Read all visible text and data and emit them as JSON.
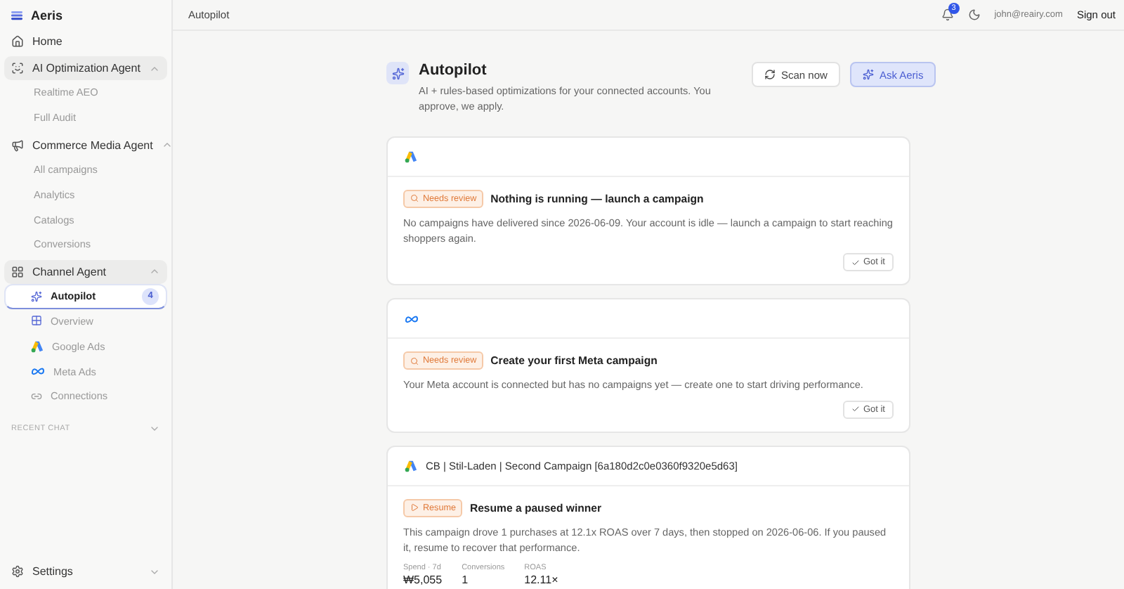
{
  "sidebar": {
    "brand": "Aeris",
    "items": [
      {
        "kind": "link",
        "label": "Home",
        "active": false
      },
      {
        "kind": "group",
        "label": "AI Optimization Agent",
        "active": true,
        "expanded": true,
        "children": [
          {
            "label": "Realtime AEO",
            "selected": false
          },
          {
            "label": "Full Audit",
            "selected": false
          }
        ]
      },
      {
        "kind": "group",
        "label": "Commerce Media Agent",
        "active": false,
        "expanded": true,
        "children": [
          {
            "label": "All campaigns",
            "selected": false
          },
          {
            "label": "Analytics",
            "selected": false
          },
          {
            "label": "Catalogs",
            "selected": false
          },
          {
            "label": "Conversions",
            "selected": false
          }
        ]
      },
      {
        "kind": "group",
        "label": "Channel Agent",
        "active": true,
        "expanded": true,
        "children": [
          {
            "label": "Autopilot",
            "selected": true,
            "badge": "4"
          },
          {
            "label": "Overview",
            "selected": false
          },
          {
            "label": "Google Ads",
            "selected": false
          },
          {
            "label": "Meta Ads",
            "selected": false
          },
          {
            "label": "Connections",
            "selected": false
          }
        ]
      }
    ],
    "recent_chat": {
      "label": "RECENT CHAT",
      "expanded": false
    },
    "settings": {
      "label": "Settings",
      "expanded": false
    }
  },
  "header": {
    "title": "Autopilot",
    "notifications": "3",
    "user": "john@reairy.com",
    "sign_out": "Sign out"
  },
  "page": {
    "title": "Autopilot",
    "subtitle": "AI + rules-based optimizations for your connected accounts. You approve, we apply.",
    "buttons": [
      {
        "kind": "scan",
        "label": "Scan now"
      },
      {
        "kind": "ask",
        "label": "Ask Aeris"
      }
    ]
  },
  "cards": [
    {
      "kind": "google",
      "badge": {
        "kind": "review",
        "label": "Needs review"
      },
      "title": "Nothing is running — launch a campaign",
      "text": "No campaigns have delivered since 2026-06-09. Your account is idle — launch a campaign to start reaching shoppers again.",
      "action": "Got it"
    },
    {
      "kind": "meta",
      "badge": {
        "kind": "review",
        "label": "Needs review"
      },
      "title": "Create your first Meta campaign",
      "text": "Your Meta account is connected but has no campaigns yet — create one to start driving performance.",
      "action": "Got it"
    },
    {
      "kind": "google",
      "campaign": "CB | Stil-Laden | Second Campaign [6a180d2c0e0360f9320e5d63]",
      "badge": {
        "kind": "resume",
        "label": "Resume"
      },
      "title": "Resume a paused winner",
      "text": "This campaign drove 1 purchases at 12.1x ROAS over 7 days, then stopped on 2026-06-06. If you paused it, resume to recover that performance.",
      "stats": [
        {
          "label": "Spend · 7d",
          "value": "₩5,055"
        },
        {
          "label": "Conversions",
          "value": "1"
        },
        {
          "label": "ROAS",
          "value": "12.11×"
        }
      ]
    }
  ]
}
